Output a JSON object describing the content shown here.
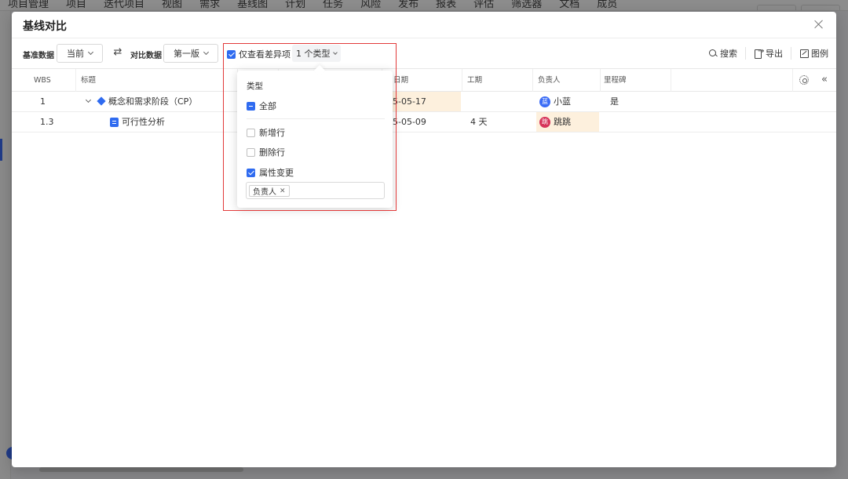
{
  "background": {
    "nav": [
      "项目管理",
      "项目",
      "迭代项目",
      "视图",
      "需求",
      "基线图",
      "计划",
      "任务",
      "风险",
      "发布",
      "报表",
      "评估",
      "筛选器",
      "文档",
      "成员"
    ]
  },
  "modal": {
    "title": "基线对比",
    "toolbar": {
      "base_label": "基准数据",
      "base_value": "当前",
      "compare_label": "对比数据",
      "compare_value": "第一版",
      "diff_only_label": "仅查看差异项",
      "diff_only_checked": true,
      "type_filter": "1 个类型",
      "search": "搜索",
      "export": "导出",
      "legend": "图例"
    },
    "table": {
      "columns": [
        "WBS",
        "标题",
        "",
        "",
        "日期",
        "工期",
        "负责人",
        "里程碑",
        ""
      ],
      "rows": [
        {
          "wbs": "1",
          "title": "概念和需求阶段（CP）",
          "date": "5-05-17",
          "duration": "",
          "owner": "小蓝",
          "owner_avatar": "蓝",
          "owner_color": "#3b6cf6",
          "milestone": "是"
        },
        {
          "wbs": "1.3",
          "title": "可行性分析",
          "date": "5-05-09",
          "duration": "4 天",
          "owner": "跳跳",
          "owner_avatar": "跳",
          "owner_color": "#d6345a",
          "milestone": ""
        }
      ]
    },
    "dropdown": {
      "title": "类型",
      "all": "全部",
      "options": [
        {
          "label": "新增行",
          "checked": false
        },
        {
          "label": "删除行",
          "checked": false
        },
        {
          "label": "属性变更",
          "checked": true
        }
      ],
      "tag": "负责人"
    }
  },
  "colors": {
    "accent": "#2f6bf0",
    "highlight": "#fdf0dd",
    "annotation": "#e23a3a"
  }
}
